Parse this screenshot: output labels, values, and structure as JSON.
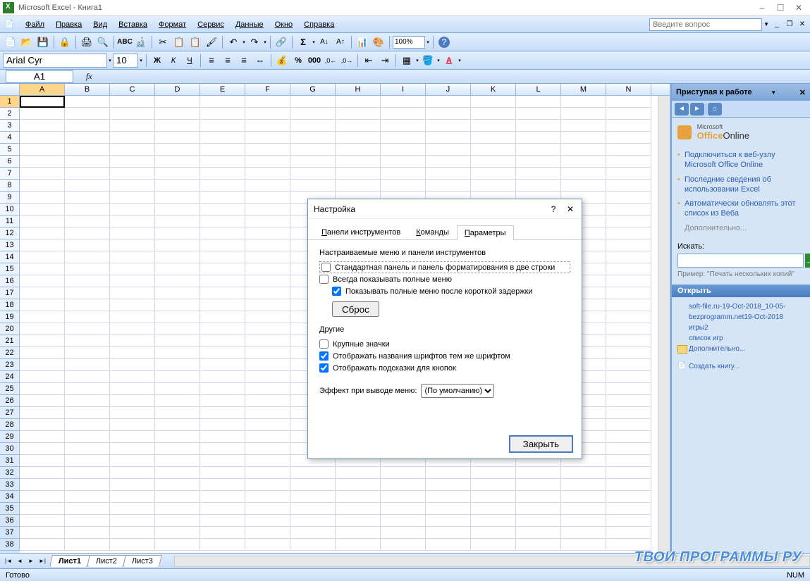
{
  "titlebar": {
    "title": "Microsoft Excel - Книга1"
  },
  "menubar": {
    "items": [
      "Файл",
      "Правка",
      "Вид",
      "Вставка",
      "Формат",
      "Сервис",
      "Данные",
      "Окно",
      "Справка"
    ],
    "ask_placeholder": "Введите вопрос"
  },
  "toolbar1": {
    "zoom": "100%"
  },
  "toolbar2": {
    "font_name": "Arial Cyr",
    "font_size": "10"
  },
  "formulabar": {
    "cell_ref": "A1",
    "fx": "fx",
    "formula": ""
  },
  "columns": [
    "A",
    "B",
    "C",
    "D",
    "E",
    "F",
    "G",
    "H",
    "I",
    "J",
    "K",
    "L",
    "M",
    "N"
  ],
  "rows": 38,
  "sheets": [
    "Лист1",
    "Лист2",
    "Лист3"
  ],
  "statusbar": {
    "ready": "Готово",
    "num": "NUM"
  },
  "taskpane": {
    "title": "Приступая к работе",
    "office_ms": "Microsoft",
    "office_off": "Office",
    "office_on": "Online",
    "links": [
      "Подключиться к веб-узлу Microsoft Office Online",
      "Последние сведения об использовании Excel",
      "Автоматически обновлять этот список из Веба"
    ],
    "more": "Дополнительно...",
    "search_label": "Искать:",
    "search_hint": "Пример:  \"Печать нескольких копий\"",
    "open_head": "Открыть",
    "open_items": [
      "soft-file.ru-19-Oct-2018_10-05-",
      "bezprogramm.net19-Oct-2018",
      "игры2",
      "список игр"
    ],
    "open_more": "Дополнительно...",
    "create": "Создать книгу..."
  },
  "dialog": {
    "title": "Настройка",
    "tabs": [
      "Панели инструментов",
      "Команды",
      "Параметры"
    ],
    "group1": "Настраиваемые меню и панели инструментов",
    "check1": "Стандартная панель и панель форматирования в две строки",
    "check2": "Всегда показывать полные меню",
    "check3": "Показывать полные меню после короткой задержки",
    "reset": "Сброс",
    "group2": "Другие",
    "check4": "Крупные значки",
    "check5": "Отображать названия шрифтов тем же шрифтом",
    "check6": "Отображать подсказки для кнопок",
    "effect_label": "Эффект при выводе меню:",
    "effect_value": "(По умолчанию)",
    "close": "Закрыть"
  },
  "watermark": "ТВОИ ПРОГРАММЫ РУ"
}
